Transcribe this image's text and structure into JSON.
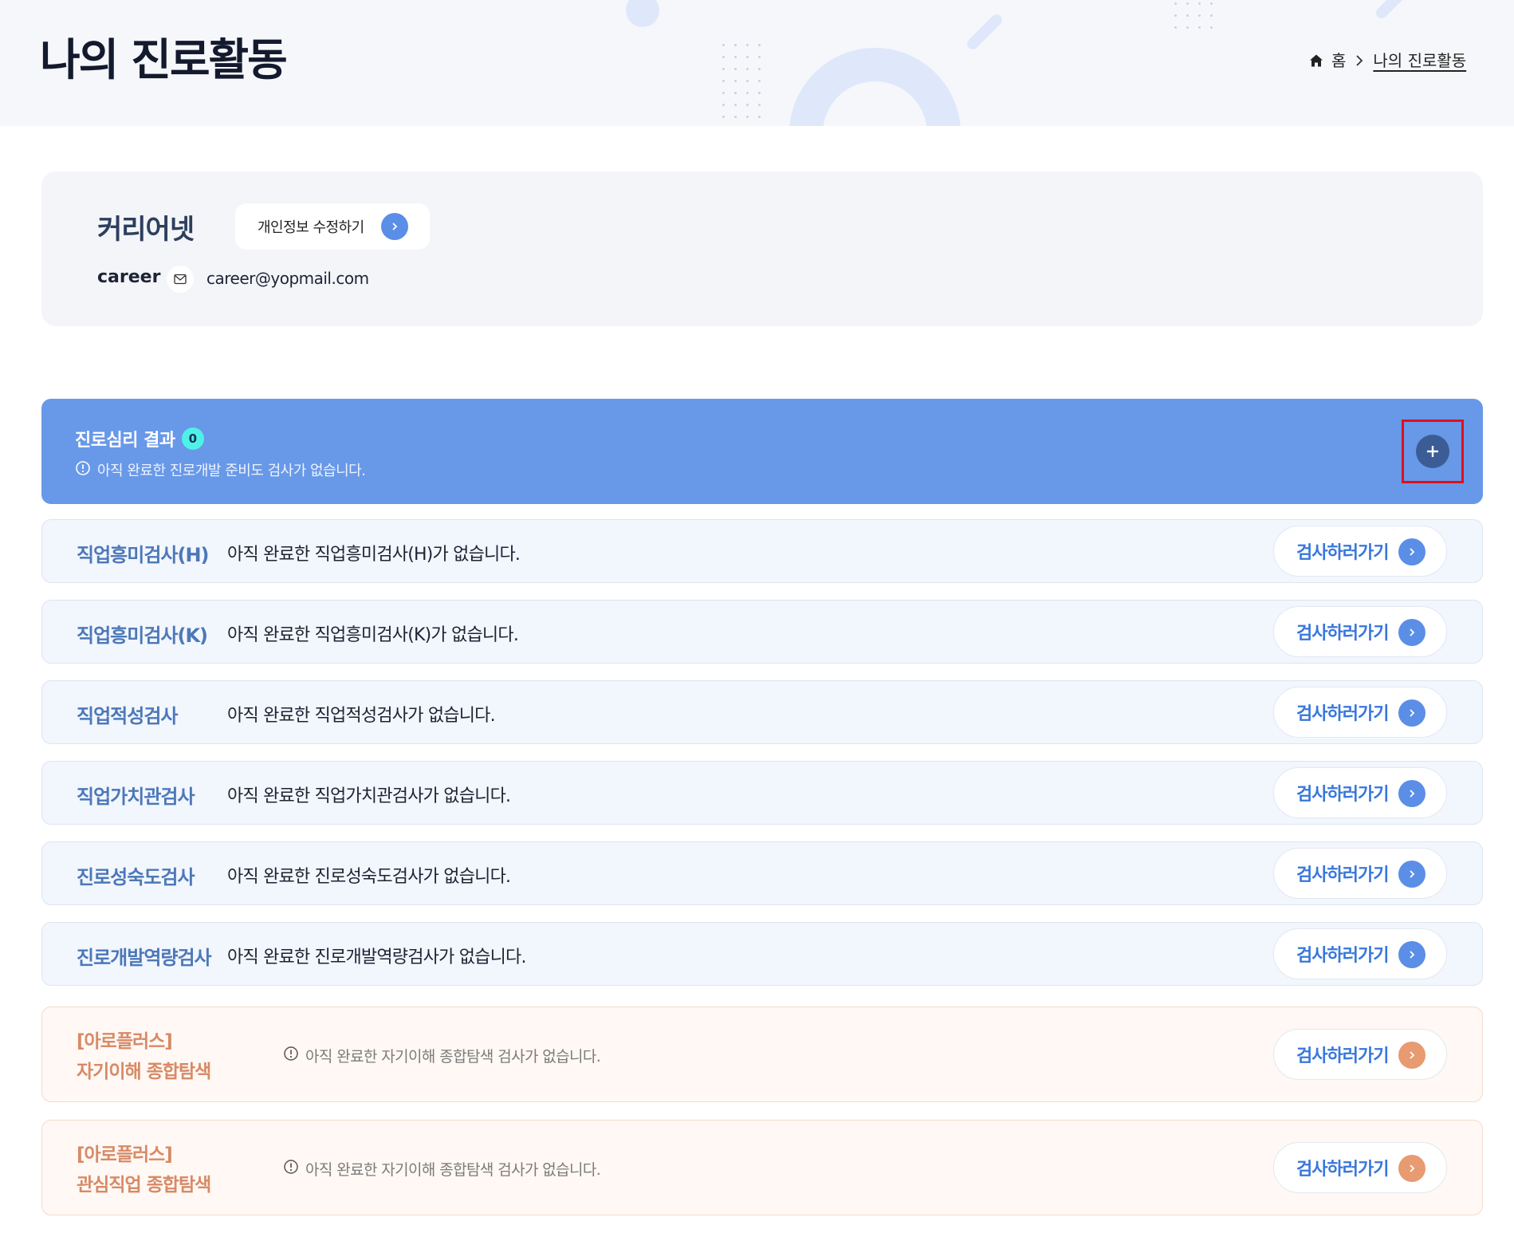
{
  "header": {
    "title": "나의 진로활동",
    "breadcrumb": {
      "home": "홈",
      "current": "나의 진로활동"
    }
  },
  "profile": {
    "name": "커리어넷",
    "edit_label": "개인정보 수정하기",
    "user_id": "career",
    "email": "career@yopmail.com"
  },
  "section": {
    "title": "진로심리 결과",
    "count": "0",
    "note": "아직 완료한 진로개발 준비도 검사가 없습니다."
  },
  "tests": [
    {
      "name": "직업흥미검사(H)",
      "desc": "아직 완료한 직업흥미검사(H)가 없습니다.",
      "button": "검사하러가기"
    },
    {
      "name": "직업흥미검사(K)",
      "desc": "아직 완료한 직업흥미검사(K)가 없습니다.",
      "button": "검사하러가기"
    },
    {
      "name": "직업적성검사",
      "desc": "아직 완료한 직업적성검사가 없습니다.",
      "button": "검사하러가기"
    },
    {
      "name": "직업가치관검사",
      "desc": "아직 완료한 직업가치관검사가 없습니다.",
      "button": "검사하러가기"
    },
    {
      "name": "진로성숙도검사",
      "desc": "아직 완료한 진로성숙도검사가 없습니다.",
      "button": "검사하러가기"
    },
    {
      "name": "진로개발역량검사",
      "desc": "아직 완료한 진로개발역량검사가 없습니다.",
      "button": "검사하러가기"
    }
  ],
  "aroplus": [
    {
      "line1": "[아로플러스]",
      "line2": "자기이해 종합탐색",
      "note": "아직 완료한 자기이해 종합탐색 검사가 없습니다.",
      "button": "검사하러가기"
    },
    {
      "line1": "[아로플러스]",
      "line2": "관심직업 종합탐색",
      "note": "아직 완료한 자기이해 종합탐색 검사가 없습니다.",
      "button": "검사하러가기"
    }
  ],
  "colors": {
    "accent": "#6898e8",
    "blue_text": "#4c78b8",
    "orange_text": "#d78a66",
    "highlight": "#e00f1a"
  }
}
